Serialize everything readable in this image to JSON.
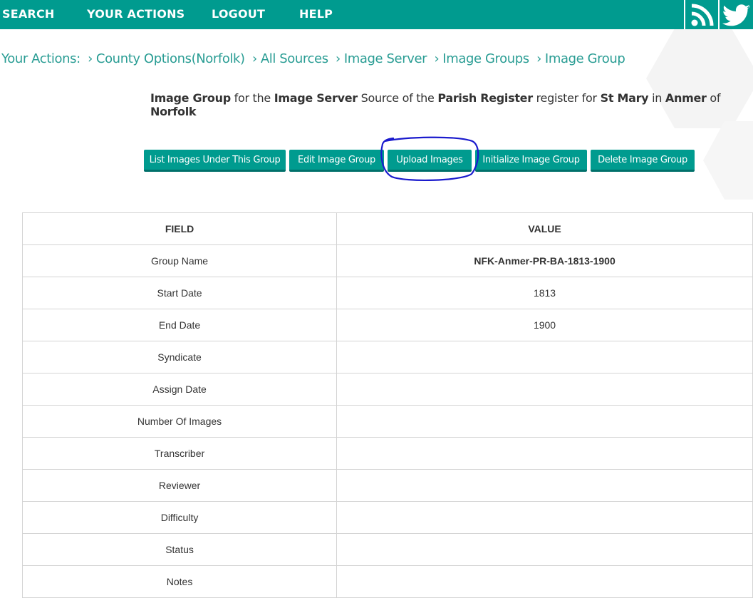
{
  "nav": {
    "items": [
      "SEARCH",
      "YOUR ACTIONS",
      "LOGOUT",
      "HELP"
    ],
    "social": [
      "rss-icon",
      "twitter-icon"
    ],
    "colors": {
      "bar": "#009b8f",
      "text": "#ffffff"
    }
  },
  "breadcrumb": {
    "prefix": "Your Actions:",
    "items": [
      "County Options(Norfolk)",
      "All Sources",
      "Image Server",
      "Image Groups",
      "Image Group"
    ],
    "separator": "›"
  },
  "description": {
    "entity": "Image Group",
    "t1": "for the",
    "source": "Image Server",
    "t2": "Source of the",
    "register_type": "Parish Register",
    "t3": "register for",
    "church": "St Mary",
    "t4": "in",
    "place": "Anmer",
    "t5": "of",
    "county": "Norfolk"
  },
  "buttons": {
    "list_images": "List Images Under This Group",
    "edit_group": "Edit Image Group",
    "upload_images": "Upload Images",
    "initialize_group": "Initialize Image Group",
    "delete_group": "Delete Image Group"
  },
  "table": {
    "headers": {
      "field": "FIELD",
      "value": "VALUE"
    },
    "rows": [
      {
        "field": "Group Name",
        "value": "NFK-Anmer-PR-BA-1813-1900"
      },
      {
        "field": "Start Date",
        "value": "1813"
      },
      {
        "field": "End Date",
        "value": "1900"
      },
      {
        "field": "Syndicate",
        "value": ""
      },
      {
        "field": "Assign Date",
        "value": ""
      },
      {
        "field": "Number Of Images",
        "value": ""
      },
      {
        "field": "Transcriber",
        "value": ""
      },
      {
        "field": "Reviewer",
        "value": ""
      },
      {
        "field": "Difficulty",
        "value": ""
      },
      {
        "field": "Status",
        "value": ""
      },
      {
        "field": "Notes",
        "value": ""
      }
    ]
  },
  "colors": {
    "accent": "#009b8f",
    "link": "#2a9d94",
    "annotation": "#1a1acd"
  }
}
